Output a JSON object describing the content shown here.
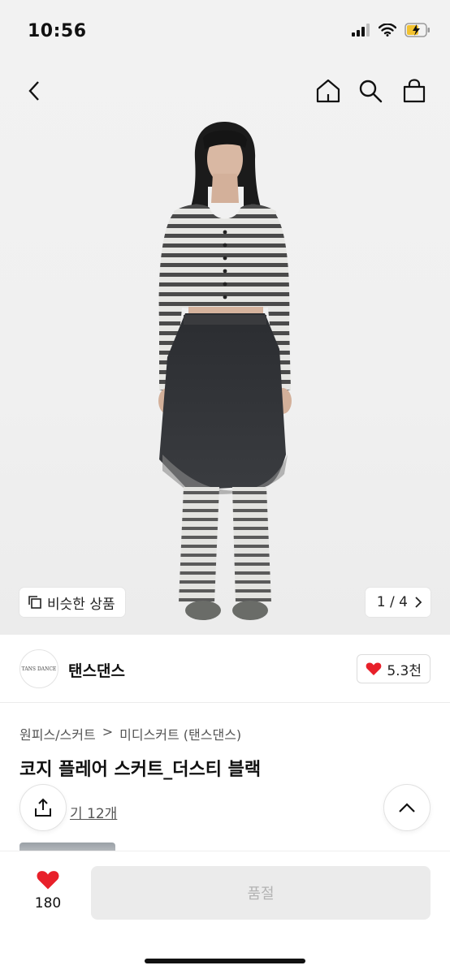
{
  "status": {
    "time": "10:56"
  },
  "nav": {
    "icons": [
      "back-icon",
      "home-icon",
      "search-icon",
      "shopping-bag-icon"
    ]
  },
  "gallery": {
    "similar_label": "비슷한 상품",
    "page_current": "1",
    "page_total": "4",
    "page_separator": "/"
  },
  "brand": {
    "logo_text": "TANS DANCE",
    "name": "탠스댄스",
    "likes": "5.3천"
  },
  "product": {
    "breadcrumb": [
      "원피스/스커트",
      "미디스커트 (탠스댄스)"
    ],
    "breadcrumb_separator": ">",
    "title": "코지 플레어 스커트_더스티 블랙",
    "review_link": "기 12개"
  },
  "bottom": {
    "wish_count": "180",
    "soldout_label": "품절"
  },
  "colors": {
    "accent_red": "#e8202a",
    "text_dark": "#111111",
    "disabled_bg": "#ebebeb"
  }
}
